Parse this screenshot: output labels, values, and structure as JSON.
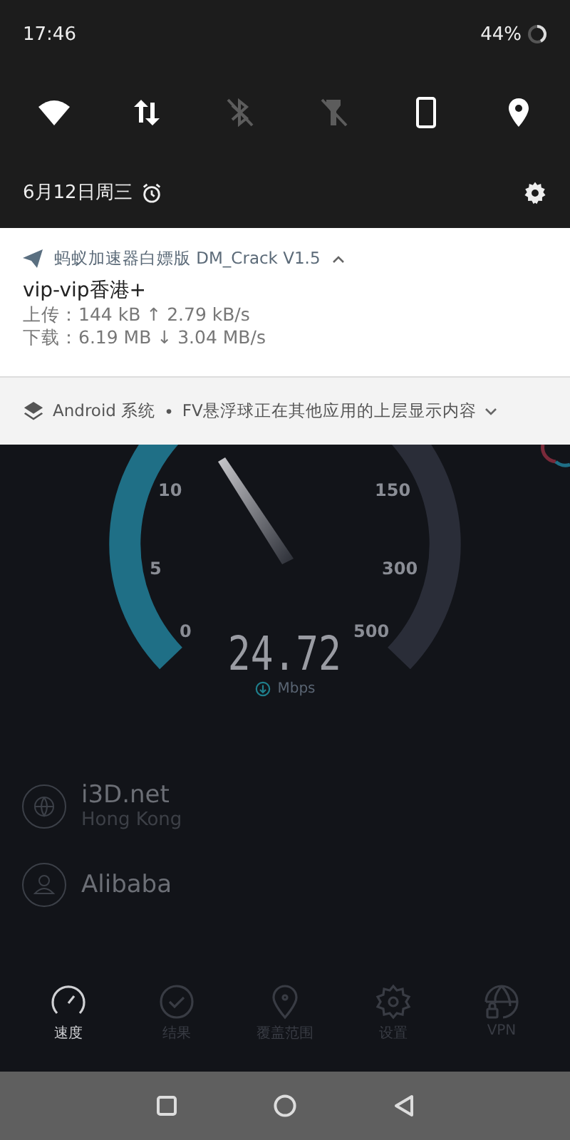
{
  "status_bar": {
    "time": "17:46",
    "battery": "44%"
  },
  "quick_tiles": [
    {
      "kind": "wifi",
      "on": true
    },
    {
      "kind": "data",
      "on": true
    },
    {
      "kind": "bluetooth",
      "on": false
    },
    {
      "kind": "flashlight",
      "on": false
    },
    {
      "kind": "rotation",
      "on": true
    },
    {
      "kind": "location",
      "on": true
    }
  ],
  "date": "6月12日周三",
  "notification": {
    "app": "蚂蚁加速器白嫖版 DM_Crack V1.5",
    "expanded": true,
    "title": "vip-vip香港+",
    "lines": [
      "上传：144 kB ↑ 2.79 kB/s",
      "下载：6.19 MB ↓ 3.04 MB/s"
    ]
  },
  "system_notification": {
    "app": "Android 系统",
    "separator": "•",
    "text": "FV悬浮球正在其他应用的上层显示内容",
    "expanded": false
  },
  "gauge": {
    "scale": [
      "0",
      "5",
      "10",
      "150",
      "300",
      "500"
    ],
    "value": "24.72",
    "unit": "Mbps"
  },
  "servers": [
    {
      "kind": "globe",
      "name": "i3D.net",
      "location": "Hong Kong"
    },
    {
      "kind": "person",
      "name": "Alibaba"
    }
  ],
  "bottom_nav": [
    {
      "kind": "speed",
      "label": "速度",
      "selected": true
    },
    {
      "kind": "results",
      "label": "结果",
      "selected": false
    },
    {
      "kind": "coverage",
      "label": "覆盖范围",
      "selected": false
    },
    {
      "kind": "settings",
      "label": "设置",
      "selected": false
    },
    {
      "kind": "vpn",
      "label": "VPN",
      "selected": false
    }
  ]
}
